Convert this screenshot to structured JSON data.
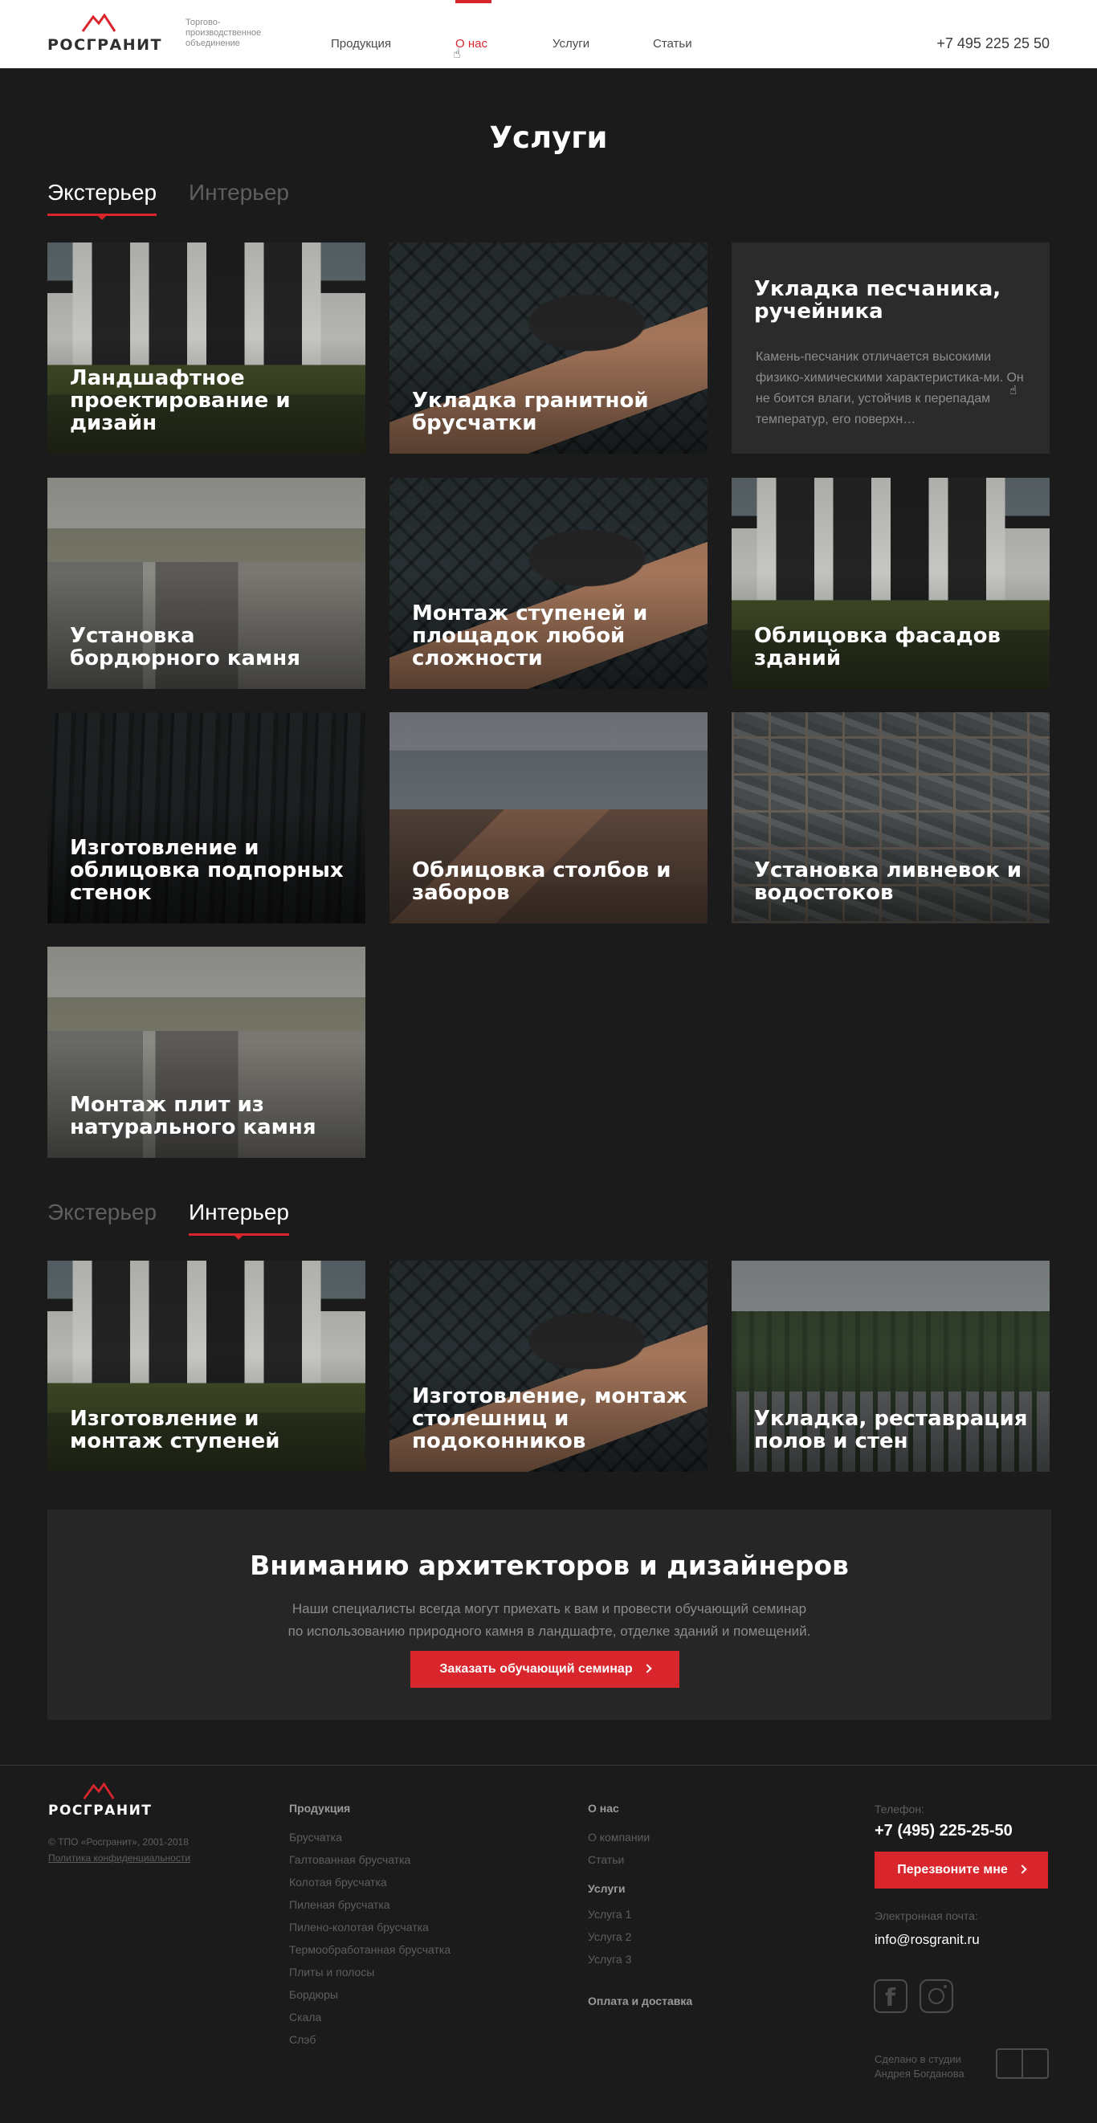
{
  "header": {
    "logo_text": "РОСГРАНИТ",
    "tagline": "Торгово-производственное объединение",
    "nav": [
      "Продукция",
      "О нас",
      "Услуги",
      "Статьи"
    ],
    "phone": "+7 495 225 25 50"
  },
  "services": {
    "title": "Услуги",
    "tabs_top": {
      "exterior": "Экстерьер",
      "interior": "Интерьер"
    },
    "exterior_cards": [
      {
        "title": "Ландшафтное проектирование и дизайн",
        "image": "house-photo"
      },
      {
        "title": "Укладка гранитной брусчатки",
        "image": "paver-hammer-photo"
      },
      {
        "title": "Укладка песчаника, ручейника",
        "description": "Камень-песчаник отличается высокими физико-химическими характеристика-ми. Он не боится влаги, устойчив к перепадам температур, его поверхн…"
      },
      {
        "title": "Установка бордюрного камня",
        "image": "quarry-photo"
      },
      {
        "title": "Монтаж ступеней и площадок любой сложности",
        "image": "paver-hammer-photo"
      },
      {
        "title": "Облицовка фасадов зданий",
        "image": "house-photo"
      },
      {
        "title": "Изготовление и облицовка подпорных стенок",
        "image": "stone-wall-photo"
      },
      {
        "title": "Облицовка столбов и заборов",
        "image": "cliff-photo"
      },
      {
        "title": "Установка ливневок и  водостоков",
        "image": "tiles-photo"
      },
      {
        "title": "Монтаж плит из натурального камня",
        "image": "quarry-photo"
      }
    ],
    "interior_cards": [
      {
        "title": "Изготовление и монтаж ступеней",
        "image": "house-photo"
      },
      {
        "title": "Изготовление, монтаж столешниц и подоконников",
        "image": "paver-hammer-photo"
      },
      {
        "title": "Укладка, реставрация полов и стен",
        "image": "forest-photo"
      }
    ]
  },
  "banner": {
    "title": "Вниманию архитекторов и дизайнеров",
    "line1": "Наши специалисты всегда могут приехать к вам и провести обучающий семинар",
    "line2": "по использованию природного камня в ландшафте, отделке зданий и помещений.",
    "button": "Заказать обучающий семинар"
  },
  "footer": {
    "logo_text": "РОСГРАНИТ",
    "copyright": "© ТПО «Росгранит», 2001-2018",
    "policy": "Политика конфиденциальности",
    "products": {
      "heading": "Продукция",
      "items": [
        "Брусчатка",
        "Галтованная брусчатка",
        "Колотая брусчатка",
        "Пиленая брусчатка",
        "Пилено-колотая брусчатка",
        "Термообработанная брусчатка",
        "Плиты и полосы",
        "Бордюры",
        "Скала",
        "Слэб"
      ]
    },
    "about": {
      "heading": "О нас",
      "items": [
        "О компании",
        "Статьи"
      ],
      "services_heading": "Услуги",
      "services_items": [
        "Услуга 1",
        "Услуга 2",
        "Услуга 3"
      ],
      "delivery": "Оплата и доставка"
    },
    "contact": {
      "phone_label": "Телефон:",
      "phone": "+7 (495) 225-25-50",
      "callback_button": "Перезвоните мне",
      "email_label": "Электронная почта:",
      "email": "info@rosgranit.ru"
    },
    "studio": {
      "line1": "Сделано в студии",
      "line2": "Андрея  Богданова"
    }
  },
  "colors": {
    "accent": "#d9262c",
    "background": "#1b1b1c",
    "panel": "#262627"
  }
}
